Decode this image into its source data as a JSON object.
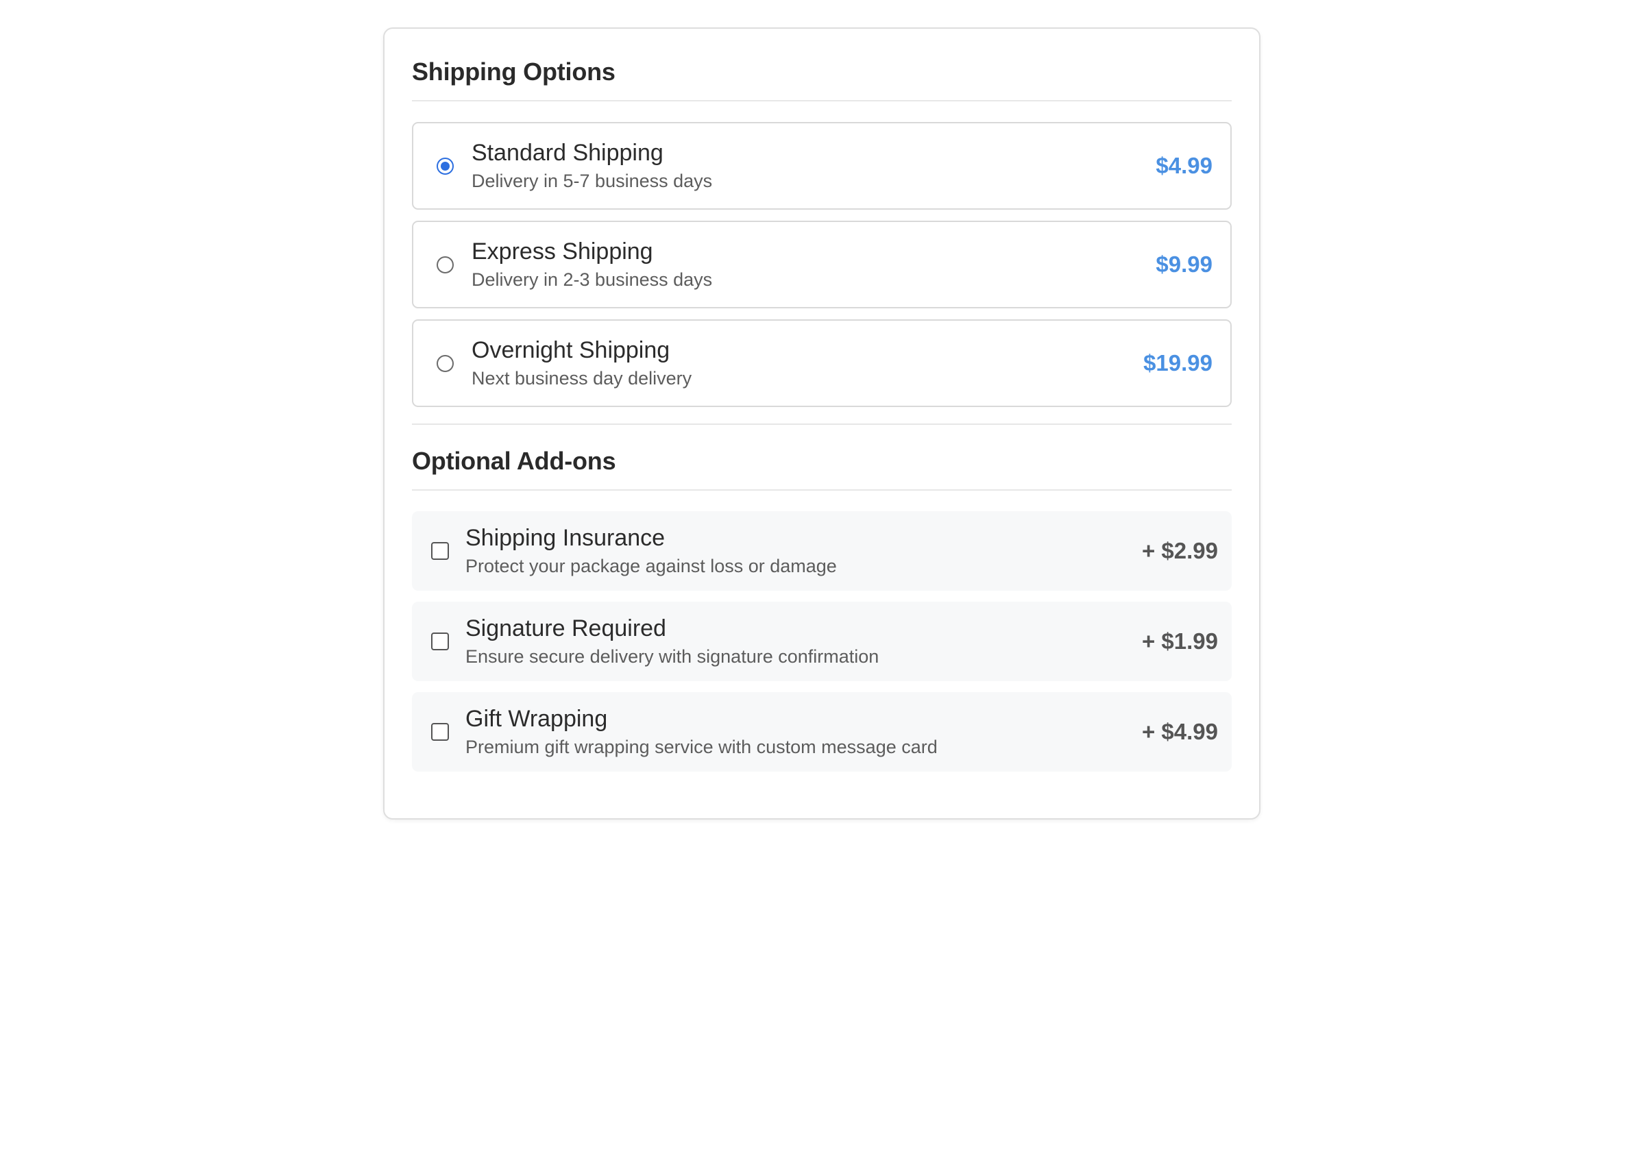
{
  "shipping": {
    "title": "Shipping Options",
    "options": [
      {
        "name": "Standard Shipping",
        "desc": "Delivery in 5-7 business days",
        "price": "$4.99",
        "selected": true
      },
      {
        "name": "Express Shipping",
        "desc": "Delivery in 2-3 business days",
        "price": "$9.99",
        "selected": false
      },
      {
        "name": "Overnight Shipping",
        "desc": "Next business day delivery",
        "price": "$19.99",
        "selected": false
      }
    ]
  },
  "addons": {
    "title": "Optional Add-ons",
    "items": [
      {
        "name": "Shipping Insurance",
        "desc": "Protect your package against loss or damage",
        "price": "+ $2.99",
        "checked": false
      },
      {
        "name": "Signature Required",
        "desc": "Ensure secure delivery with signature confirmation",
        "price": "+ $1.99",
        "checked": false
      },
      {
        "name": "Gift Wrapping",
        "desc": "Premium gift wrapping service with custom message card",
        "price": "+ $4.99",
        "checked": false
      }
    ]
  },
  "colors": {
    "accent": "#4a90e2",
    "radio_selected": "#2d6fe0",
    "addon_bg": "#f7f8f9"
  }
}
